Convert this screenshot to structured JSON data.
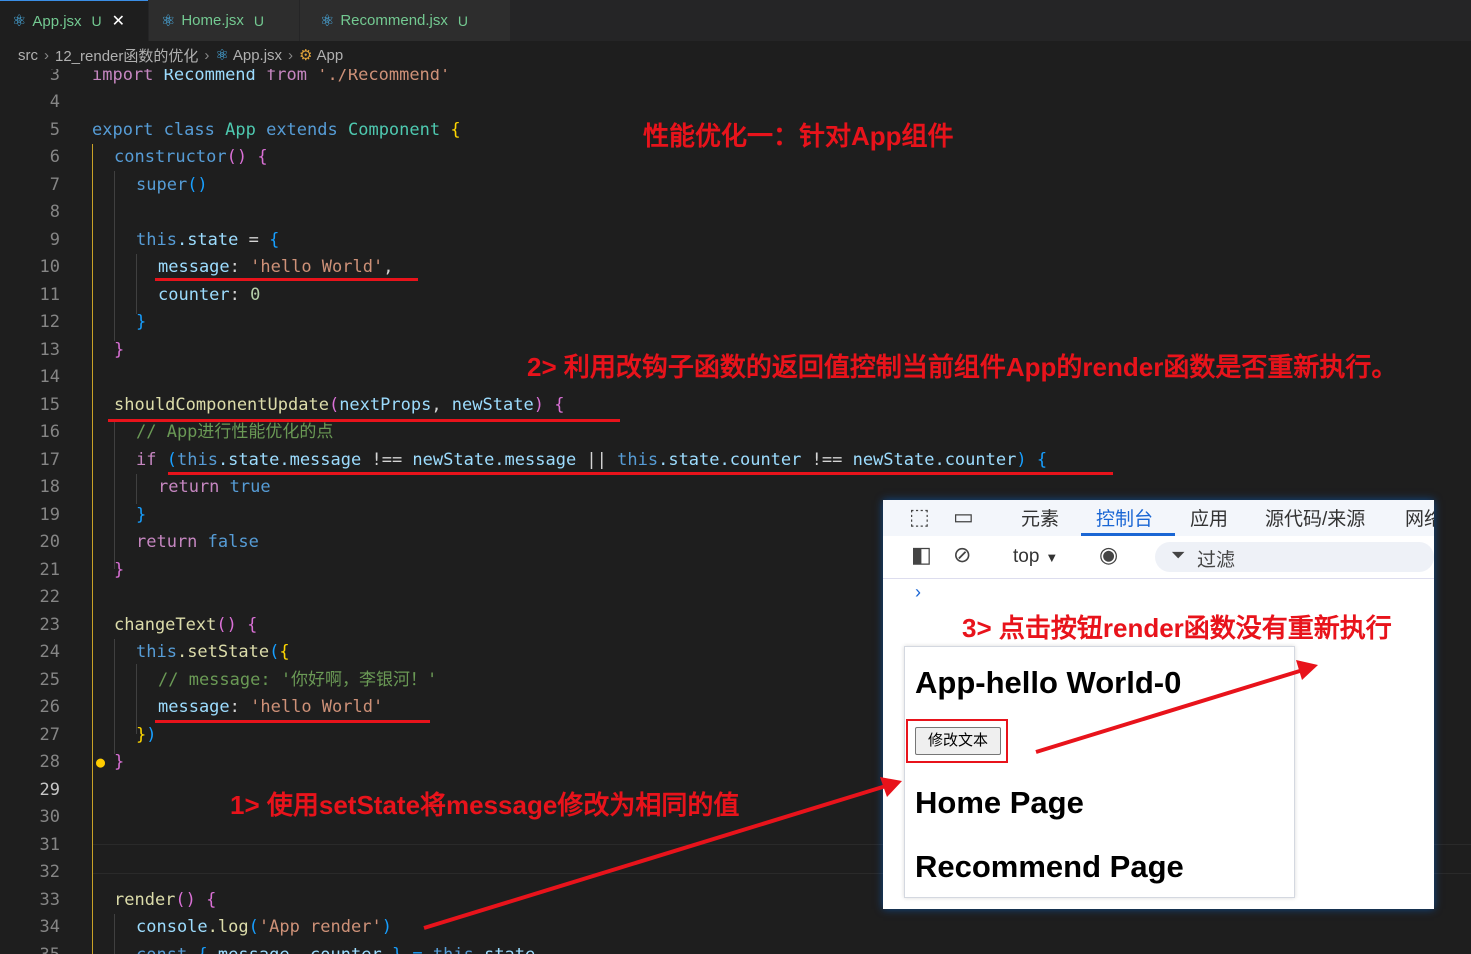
{
  "tabs": [
    {
      "label": "App.jsx",
      "status": "U",
      "close": "✕"
    },
    {
      "label": "Home.jsx",
      "status": "U"
    },
    {
      "label": "Recommend.jsx",
      "status": "U"
    }
  ],
  "breadcrumb": [
    "src",
    "12_render函数的优化",
    "App.jsx",
    "App"
  ],
  "lines": {
    "n3": "3",
    "n4": "4",
    "n5": "5",
    "n6": "6",
    "n7": "7",
    "n8": "8",
    "n9": "9",
    "n10": "10",
    "n11": "11",
    "n12": "12",
    "n13": "13",
    "n14": "14",
    "n15": "15",
    "n16": "16",
    "n17": "17",
    "n18": "18",
    "n19": "19",
    "n20": "20",
    "n21": "21",
    "n22": "22",
    "n23": "23",
    "n24": "24",
    "n25": "25",
    "n26": "26",
    "n27": "27",
    "n28": "28",
    "n29": "29",
    "n30": "30",
    "n31": "31",
    "n32": "32",
    "n33": "33",
    "n34": "34",
    "n35": "35"
  },
  "code": {
    "l3": [
      "import",
      " Recommend ",
      "from",
      " './Recommend'"
    ],
    "l5": [
      "export",
      " ",
      "class",
      " ",
      "App",
      " ",
      "extends",
      " ",
      "Component",
      " ",
      "{"
    ],
    "l6": [
      "constructor",
      "()",
      " ",
      "{"
    ],
    "l7": [
      "super",
      "()"
    ],
    "l9": [
      "this",
      ".state",
      " = ",
      "{"
    ],
    "l10": [
      "message",
      ": ",
      "'hello World'",
      ","
    ],
    "l11": [
      "counter",
      ": ",
      "0"
    ],
    "l12": "}",
    "l13": "}",
    "l15": [
      "shouldComponentUpdate",
      "(",
      "nextProps",
      ", ",
      "newState",
      ")",
      " ",
      "{"
    ],
    "l16": "// App进行性能优化的点",
    "l17": [
      "if",
      " ",
      "(",
      "this",
      ".state.message",
      " !== ",
      "newState.message",
      " || ",
      "this",
      ".state.counter",
      " !== ",
      "newState.counter",
      ")",
      " ",
      "{"
    ],
    "l18": [
      "return",
      " ",
      "true"
    ],
    "l19": "}",
    "l20": [
      "return",
      " ",
      "false"
    ],
    "l21": "}",
    "l23": [
      "changeText",
      "()",
      " ",
      "{"
    ],
    "l24": [
      "this",
      ".setState",
      "(",
      "{"
    ],
    "l25": "// message: '你好啊，李银河！'",
    "l26": [
      "message",
      ": ",
      "'hello World'"
    ],
    "l27": [
      "}",
      ")"
    ],
    "l28": "}",
    "l33": [
      "render",
      "()",
      " ",
      "{"
    ],
    "l34": [
      "console",
      ".log",
      "(",
      "'App render'",
      ")"
    ],
    "l35": [
      "const",
      " { ",
      "message",
      ", ",
      "counter",
      " } = ",
      "this",
      ".state"
    ]
  },
  "annotations": {
    "a0": "性能优化一：针对App组件",
    "a1": "2> 利用改钩子函数的返回值控制当前组件App的render函数是否重新执行。",
    "a2": "1> 使用setState将message修改为相同的值",
    "a3": "3> 点击按钮render函数没有重新执行"
  },
  "devtools": {
    "tabs": [
      "元素",
      "控制台",
      "应用",
      "源代码/来源",
      "网络"
    ],
    "active_tab": "控制台",
    "context": "top",
    "filter_placeholder": "过滤",
    "prompt": "›"
  },
  "page": {
    "title": "App-hello World-0",
    "button": "修改文本",
    "home": "Home Page",
    "recommend": "Recommend Page"
  },
  "colors": {
    "annotation": "#e8131b",
    "accent": "#1a66d4",
    "editor_bg": "#1e1e1e"
  }
}
